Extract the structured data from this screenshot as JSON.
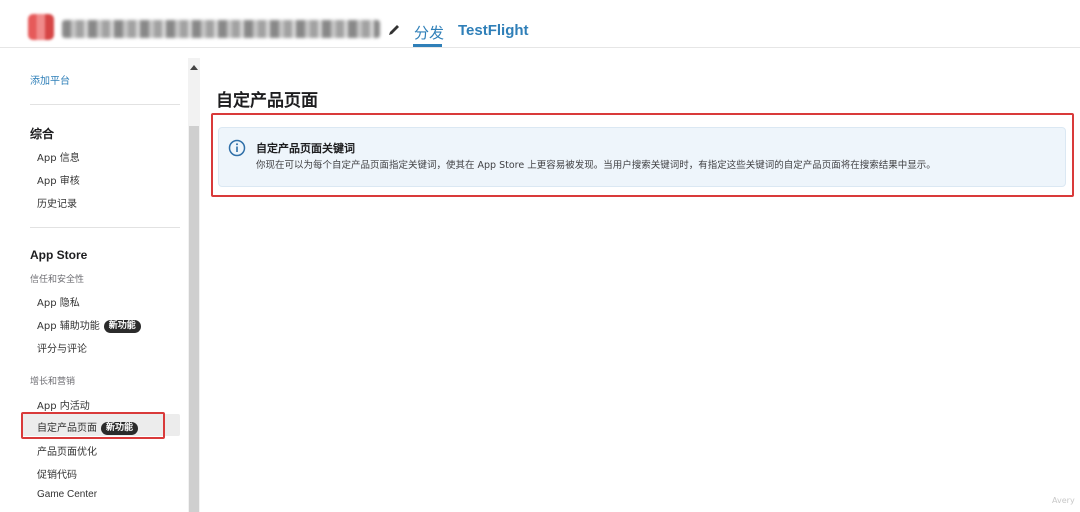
{
  "header": {
    "tabs": [
      {
        "label": "分发",
        "active": true
      },
      {
        "label": "TestFlight",
        "active": false
      }
    ]
  },
  "sidebar": {
    "add_platform": "添加平台",
    "sections": [
      {
        "heading": "综合",
        "items": [
          "App 信息",
          "App 审核",
          "历史记录"
        ]
      },
      {
        "heading": "App Store",
        "groups": [
          {
            "subheading": "信任和安全性",
            "items": [
              {
                "label": "App 隐私",
                "badge": ""
              },
              {
                "label": "App 辅助功能",
                "badge": "新功能"
              },
              {
                "label": "评分与评论",
                "badge": ""
              }
            ]
          },
          {
            "subheading": "增长和营销",
            "items": [
              {
                "label": "App 内活动",
                "badge": ""
              },
              {
                "label": "自定产品页面",
                "badge": "新功能",
                "selected": true
              },
              {
                "label": "产品页面优化",
                "badge": ""
              },
              {
                "label": "促销代码",
                "badge": ""
              },
              {
                "label": "Game Center",
                "badge": ""
              }
            ]
          }
        ]
      }
    ]
  },
  "main": {
    "title": "自定产品页面",
    "info": {
      "icon": "info-circle-icon",
      "title": "自定产品页面关键词",
      "body": "你现在可以为每个自定产品页面指定关键词，使其在 App Store 上更容易被发现。当用户搜索关键词时，有指定这些关键词的自定产品页面将在搜索结果中显示。"
    }
  },
  "watermark": "Avery",
  "colors": {
    "accent": "#2f7fb8",
    "highlight_box": "#d93a3a",
    "info_panel_bg": "#eef5fb",
    "badge_bg": "#2b2b2b"
  }
}
